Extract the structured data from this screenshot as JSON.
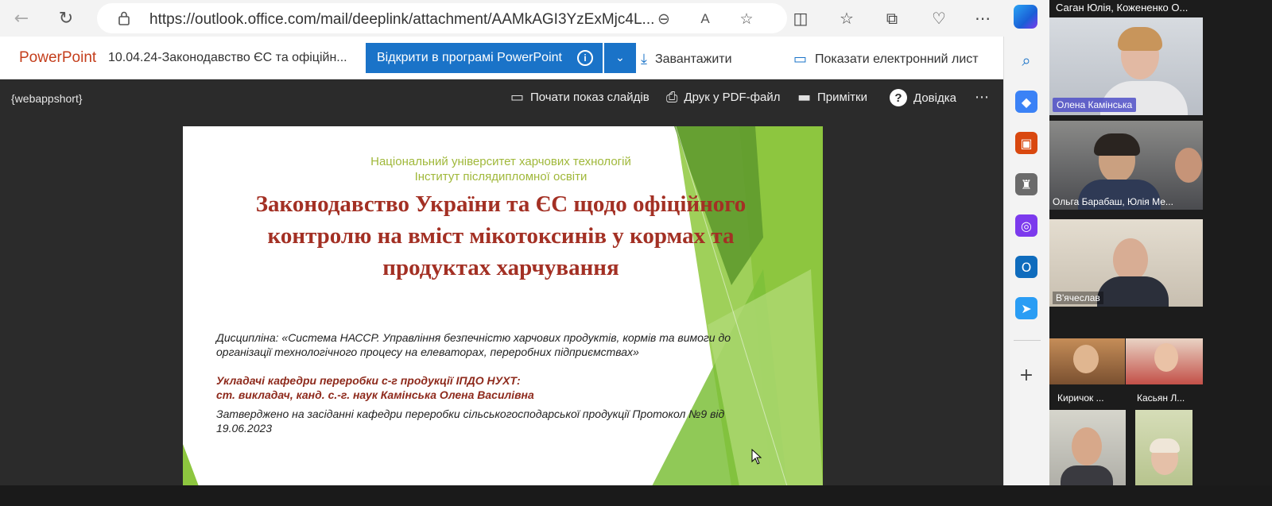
{
  "browser": {
    "url": "https://outlook.office.com/mail/deeplink/attachment/AAMkAGI3YzExMjc4L...",
    "back_icon": "back-arrow-icon",
    "refresh_icon": "refresh-icon"
  },
  "office": {
    "app_name": "PowerPoint",
    "doc_title": "10.04.24-Законодавство ЄС та офіційн...",
    "open_button_label": "Відкрити в програмі PowerPoint",
    "download_label": "Завантажити",
    "show_email_label": "Показати електронний лист"
  },
  "viewer": {
    "webappshort": "{webappshort}",
    "start_slideshow_label": "Почати показ слайдів",
    "print_pdf_label": "Друк у PDF-файл",
    "notes_label": "Примітки",
    "help_label": "Довідка"
  },
  "slide": {
    "university": "Національний університет харчових технологій",
    "institute": "Інститут післядипломної освіти",
    "title": "Законодавство України та ЄС щодо офіційного контролю на вміст мікотоксинів у кормах та продуктах харчування",
    "discipline": "Дисципліна: «Система НАССР. Управління безпечністю харчових продуктів, кормів та вимоги до організації технологічного процесу на елеваторах, переробних підприємствах»",
    "authors_line1": "Укладачі кафедри переробки с-г продукції ІПДО НУХТ:",
    "authors_line2": "ст. викладач, канд. с.-г. наук  Камінська Олена Василівна",
    "approval": "Затверджено на засіданні кафедри переробки сільськогосподарської продукції Протокол №9 від 19.06.2023"
  },
  "participants": {
    "top_label": "Саган Юлія, Кожененко О...",
    "tile1": "Олена Камінська",
    "tile2": "Ольга Барабаш, Юлія Ме...",
    "tile3": "В'ячеслав",
    "tile4": "Киричок ...",
    "tile5": "Касьян Л..."
  },
  "colors": {
    "powerpoint_brand": "#c43e1c",
    "primary_button": "#1a73c8",
    "slide_title": "#a33024",
    "slide_green": "#8dc63f"
  }
}
